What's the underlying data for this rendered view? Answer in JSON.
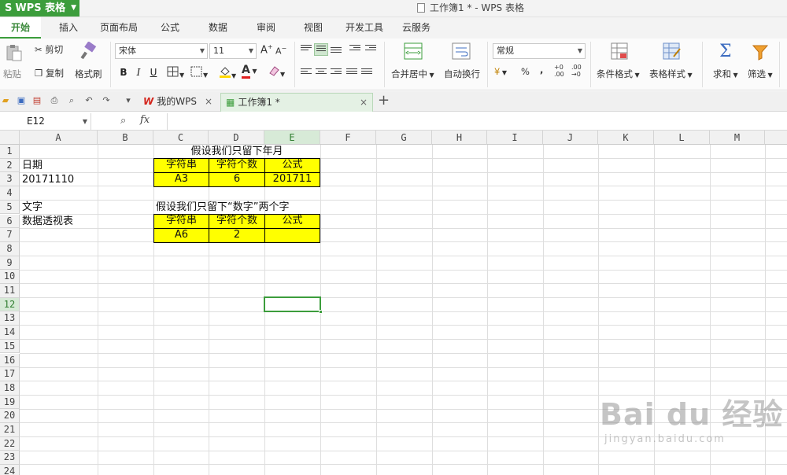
{
  "app": {
    "name": "WPS 表格",
    "logo_letter": "S"
  },
  "window_title": "工作簿1 * - WPS 表格",
  "menu_tabs": [
    "开始",
    "插入",
    "页面布局",
    "公式",
    "数据",
    "审阅",
    "视图",
    "开发工具",
    "云服务"
  ],
  "active_menu_tab": "开始",
  "ribbon": {
    "paste": "粘贴",
    "cut": "剪切",
    "copy": "复制",
    "format_painter": "格式刷",
    "font_name": "宋体",
    "font_size": "11",
    "bold": "B",
    "italic": "I",
    "underline": "U",
    "merge_center": "合并居中",
    "wrap_text": "自动换行",
    "number_format": "常规",
    "currency": "¥",
    "percent": "%",
    "thousands": ",",
    "conditional_format": "条件格式",
    "table_style": "表格样式",
    "sum": "求和",
    "filter": "筛选"
  },
  "doc_tabs": [
    {
      "label": "我的WPS",
      "active": false
    },
    {
      "label": "工作簿1 *",
      "active": true
    }
  ],
  "formula_bar": {
    "cell_ref": "E12",
    "fx": "fx",
    "value": ""
  },
  "columns": [
    "A",
    "B",
    "C",
    "D",
    "E",
    "F",
    "G",
    "H",
    "I",
    "J",
    "K",
    "L",
    "M"
  ],
  "rows": [
    "1",
    "2",
    "3",
    "4",
    "5",
    "6",
    "7",
    "8",
    "9",
    "10",
    "11",
    "12",
    "13",
    "14",
    "15",
    "16",
    "17",
    "18",
    "19",
    "20",
    "21",
    "22",
    "23",
    "24"
  ],
  "selected_cell": {
    "col": "E",
    "row": "12"
  },
  "cells": {
    "C1": "假设我们只留下年月",
    "A2": "日期",
    "A3": "20171110",
    "C2": "字符串",
    "D2": "字符个数",
    "E2": "公式",
    "C3": "A3",
    "D3": "6",
    "E3": "201711",
    "A5": "文字",
    "C5": "假设我们只留下“数字”两个字",
    "A6": "数据透视表",
    "C6": "字符串",
    "D6": "字符个数",
    "E6": "公式",
    "C7": "A6",
    "D7": "2",
    "E7": ""
  },
  "colors": {
    "accent": "#3c9d3c",
    "highlight": "#ffff00"
  },
  "watermark": {
    "main": "Bai du 经验",
    "sub": "jingyan.baidu.com"
  }
}
